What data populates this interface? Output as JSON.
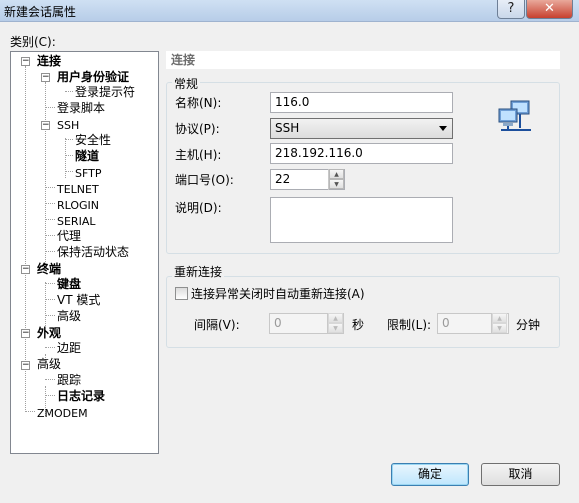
{
  "window": {
    "title": "新建会话属性",
    "help_label": "?",
    "close_label": "✕"
  },
  "category": {
    "label": "类别(C):",
    "tree": {
      "connection": "连接",
      "auth": "用户身份验证",
      "login_prompt": "登录提示符",
      "login_script": "登录脚本",
      "ssh": "SSH",
      "security": "安全性",
      "tunnel": "隧道",
      "sftp": "SFTP",
      "telnet": "TELNET",
      "rlogin": "RLOGIN",
      "serial": "SERIAL",
      "proxy": "代理",
      "keepalive": "保持活动状态",
      "terminal": "终端",
      "keyboard": "键盘",
      "vt_mode": "VT 模式",
      "term_advanced": "高级",
      "appearance": "外观",
      "margin": "边距",
      "advanced": "高级",
      "trace": "跟踪",
      "logging": "日志记录",
      "zmodem": "ZMODEM"
    }
  },
  "panel": {
    "header": "连接",
    "general": {
      "title": "常规",
      "name_label": "名称(N):",
      "name_value": "116.0",
      "protocol_label": "协议(P):",
      "protocol_value": "SSH",
      "host_label": "主机(H):",
      "host_value": "218.192.116.0",
      "port_label": "端口号(O):",
      "port_value": "22",
      "desc_label": "说明(D):",
      "desc_value": ""
    },
    "reconnect": {
      "title": "重新连接",
      "checkbox_label": "连接异常关闭时自动重新连接(A)",
      "interval_label": "间隔(V):",
      "interval_value": "0",
      "seconds_label": "秒",
      "limit_label": "限制(L):",
      "limit_value": "0",
      "minutes_label": "分钟"
    }
  },
  "buttons": {
    "ok": "确定",
    "cancel": "取消"
  },
  "spin_up": "▲",
  "spin_down": "▼",
  "expand_minus": "−",
  "colors": {
    "accent": "#3c7fb1",
    "header_text": "#6d6d6d"
  }
}
